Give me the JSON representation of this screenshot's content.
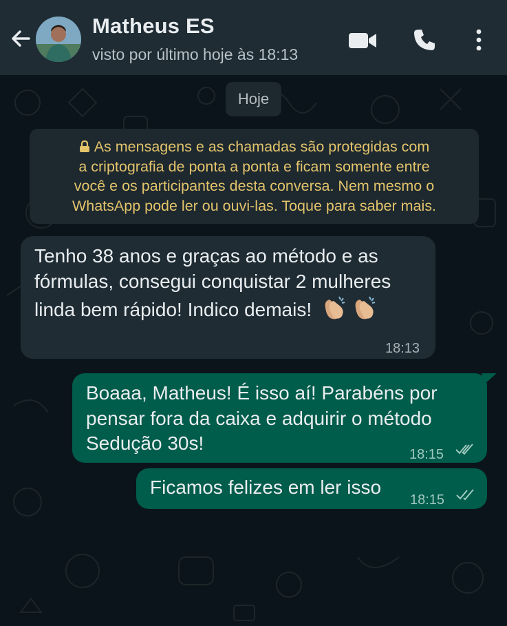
{
  "header": {
    "contact_name": "Matheus ES",
    "status": "visto por último hoje às 18:13",
    "icons": [
      "arrow-left-icon",
      "avatar",
      "video-call-icon",
      "phone-icon",
      "more-vert-icon"
    ],
    "background": "#1f2c34"
  },
  "chat": {
    "date_chip": "Hoje",
    "encryption_notice": "As mensagens e as chamadas são protegidas com a criptografia de ponta a ponta e ficam somente entre você e os participantes desta conversa. Nem mesmo o WhatsApp pode ler ou ouvi-las. Toque para saber mais.",
    "notice_lines": [
      "As mensagens e as chamadas são protegidas com",
      "a criptografia de ponta a ponta e ficam somente entre",
      "você e os participantes desta conversa. Nem mesmo o",
      "WhatsApp pode ler ou ouvi-las. Toque para saber mais."
    ],
    "messages": [
      {
        "direction": "incoming",
        "lines": [
          "Tenho 38 anos e graças ao método e as",
          "fórmulas, consegui conquistar 2 mulheres",
          "linda bem rápido! Indico demais!"
        ],
        "emoji": "clapping-hands-icon x2",
        "time": "18:13"
      },
      {
        "direction": "outgoing",
        "lines": [
          "Boaaa, Matheus! É isso aí! Parabéns por",
          "pensar fora da caixa e adquirir o método",
          "Sedução 30s!"
        ],
        "time": "18:15",
        "status": "read"
      },
      {
        "direction": "outgoing",
        "lines": [
          "Ficamos felizes em ler isso"
        ],
        "time": "18:15",
        "status": "read"
      }
    ]
  },
  "colors": {
    "chat_bg": "#0b141a",
    "incoming_bubble": "#1f2c34",
    "outgoing_bubble": "#005c4b",
    "notice_text": "#e3c46b",
    "read_ticks": "#9fc9bf"
  }
}
